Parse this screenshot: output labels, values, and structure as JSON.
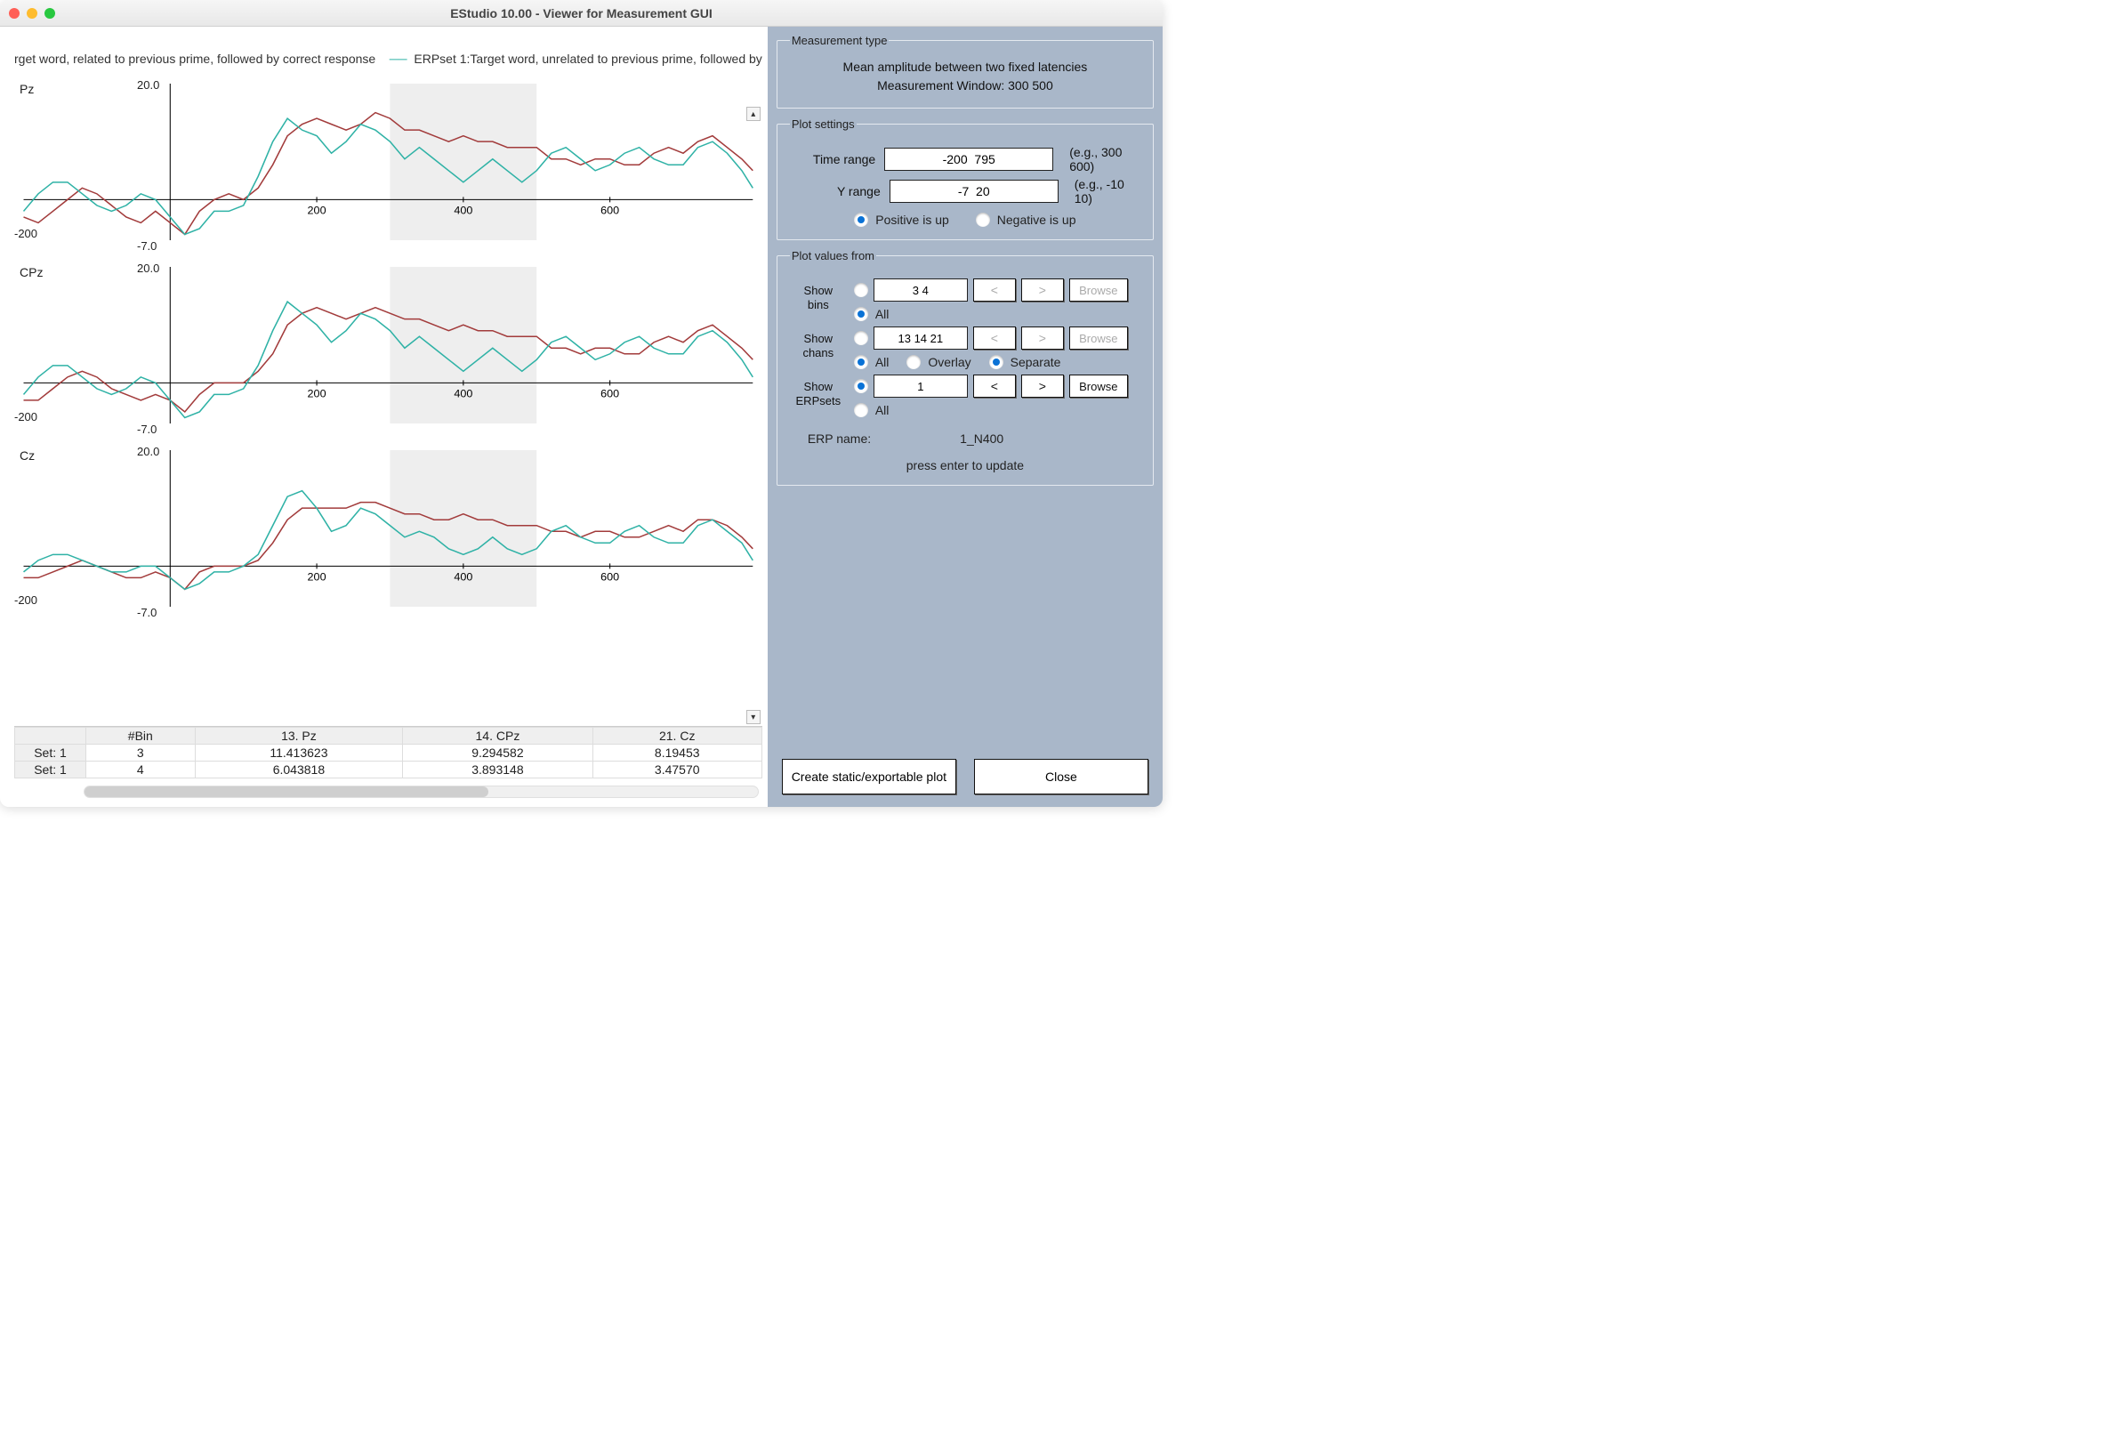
{
  "window": {
    "title": "EStudio 10.00   -   Viewer for Measurement GUI"
  },
  "legend": {
    "series1_truncated": "rget word, related to previous prime, followed by correct response",
    "series2_truncated": "ERPset 1:Target word, unrelated to previous prime, followed by"
  },
  "chart_data": [
    {
      "type": "line",
      "channel": "Pz",
      "xlabel": "",
      "ylabel": "",
      "xlim": [
        -200,
        795
      ],
      "ylim": [
        -7,
        20
      ],
      "xticks": [
        200,
        400,
        600
      ],
      "yticks": [
        -7.0,
        20.0
      ],
      "highlight_window": [
        300,
        500
      ],
      "series": [
        {
          "name": "related",
          "color": "#a23b3b",
          "x": [
            -200,
            -180,
            -160,
            -140,
            -120,
            -100,
            -80,
            -60,
            -40,
            -20,
            0,
            20,
            40,
            60,
            80,
            100,
            120,
            140,
            160,
            180,
            200,
            220,
            240,
            260,
            280,
            300,
            320,
            340,
            360,
            380,
            400,
            420,
            440,
            460,
            480,
            500,
            520,
            540,
            560,
            580,
            600,
            620,
            640,
            660,
            680,
            700,
            720,
            740,
            760,
            780,
            795
          ],
          "values": [
            -3,
            -4,
            -2,
            0,
            2,
            1,
            -1,
            -3,
            -4,
            -2,
            -4,
            -6,
            -2,
            0,
            1,
            0,
            2,
            6,
            11,
            13,
            14,
            13,
            12,
            13,
            15,
            14,
            12,
            12,
            11,
            10,
            11,
            10,
            10,
            9,
            9,
            9,
            7,
            7,
            6,
            7,
            7,
            6,
            6,
            8,
            9,
            8,
            10,
            11,
            9,
            7,
            5
          ]
        },
        {
          "name": "unrelated",
          "color": "#2fb2a6",
          "x": [
            -200,
            -180,
            -160,
            -140,
            -120,
            -100,
            -80,
            -60,
            -40,
            -20,
            0,
            20,
            40,
            60,
            80,
            100,
            120,
            140,
            160,
            180,
            200,
            220,
            240,
            260,
            280,
            300,
            320,
            340,
            360,
            380,
            400,
            420,
            440,
            460,
            480,
            500,
            520,
            540,
            560,
            580,
            600,
            620,
            640,
            660,
            680,
            700,
            720,
            740,
            760,
            780,
            795
          ],
          "values": [
            -2,
            1,
            3,
            3,
            1,
            -1,
            -2,
            -1,
            1,
            0,
            -3,
            -6,
            -5,
            -2,
            -2,
            -1,
            4,
            10,
            14,
            12,
            11,
            8,
            10,
            13,
            12,
            10,
            7,
            9,
            7,
            5,
            3,
            5,
            7,
            5,
            3,
            5,
            8,
            9,
            7,
            5,
            6,
            8,
            9,
            7,
            6,
            6,
            9,
            10,
            8,
            5,
            2
          ]
        }
      ]
    },
    {
      "type": "line",
      "channel": "CPz",
      "xlabel": "",
      "ylabel": "",
      "xlim": [
        -200,
        795
      ],
      "ylim": [
        -7,
        20
      ],
      "xticks": [
        200,
        400,
        600
      ],
      "yticks": [
        -7.0,
        20.0
      ],
      "highlight_window": [
        300,
        500
      ],
      "series": [
        {
          "name": "related",
          "color": "#a23b3b",
          "x": [
            -200,
            -180,
            -160,
            -140,
            -120,
            -100,
            -80,
            -60,
            -40,
            -20,
            0,
            20,
            40,
            60,
            80,
            100,
            120,
            140,
            160,
            180,
            200,
            220,
            240,
            260,
            280,
            300,
            320,
            340,
            360,
            380,
            400,
            420,
            440,
            460,
            480,
            500,
            520,
            540,
            560,
            580,
            600,
            620,
            640,
            660,
            680,
            700,
            720,
            740,
            760,
            780,
            795
          ],
          "values": [
            -3,
            -3,
            -1,
            1,
            2,
            1,
            -1,
            -2,
            -3,
            -2,
            -3,
            -5,
            -2,
            0,
            0,
            0,
            2,
            5,
            10,
            12,
            13,
            12,
            11,
            12,
            13,
            12,
            11,
            11,
            10,
            9,
            10,
            9,
            9,
            8,
            8,
            8,
            6,
            6,
            5,
            6,
            6,
            5,
            5,
            7,
            8,
            7,
            9,
            10,
            8,
            6,
            4
          ]
        },
        {
          "name": "unrelated",
          "color": "#2fb2a6",
          "x": [
            -200,
            -180,
            -160,
            -140,
            -120,
            -100,
            -80,
            -60,
            -40,
            -20,
            0,
            20,
            40,
            60,
            80,
            100,
            120,
            140,
            160,
            180,
            200,
            220,
            240,
            260,
            280,
            300,
            320,
            340,
            360,
            380,
            400,
            420,
            440,
            460,
            480,
            500,
            520,
            540,
            560,
            580,
            600,
            620,
            640,
            660,
            680,
            700,
            720,
            740,
            760,
            780,
            795
          ],
          "values": [
            -2,
            1,
            3,
            3,
            1,
            -1,
            -2,
            -1,
            1,
            0,
            -3,
            -6,
            -5,
            -2,
            -2,
            -1,
            3,
            9,
            14,
            12,
            10,
            7,
            9,
            12,
            11,
            9,
            6,
            8,
            6,
            4,
            2,
            4,
            6,
            4,
            2,
            4,
            7,
            8,
            6,
            4,
            5,
            7,
            8,
            6,
            5,
            5,
            8,
            9,
            7,
            4,
            1
          ]
        }
      ]
    },
    {
      "type": "line",
      "channel": "Cz",
      "xlabel": "",
      "ylabel": "",
      "xlim": [
        -200,
        795
      ],
      "ylim": [
        -7,
        20
      ],
      "xticks": [
        200,
        400,
        600
      ],
      "yticks": [
        -7.0,
        20.0
      ],
      "highlight_window": [
        300,
        500
      ],
      "series": [
        {
          "name": "related",
          "color": "#a23b3b",
          "x": [
            -200,
            -180,
            -160,
            -140,
            -120,
            -100,
            -80,
            -60,
            -40,
            -20,
            0,
            20,
            40,
            60,
            80,
            100,
            120,
            140,
            160,
            180,
            200,
            220,
            240,
            260,
            280,
            300,
            320,
            340,
            360,
            380,
            400,
            420,
            440,
            460,
            480,
            500,
            520,
            540,
            560,
            580,
            600,
            620,
            640,
            660,
            680,
            700,
            720,
            740,
            760,
            780,
            795
          ],
          "values": [
            -2,
            -2,
            -1,
            0,
            1,
            0,
            -1,
            -2,
            -2,
            -1,
            -2,
            -4,
            -1,
            0,
            0,
            0,
            1,
            4,
            8,
            10,
            10,
            10,
            10,
            11,
            11,
            10,
            9,
            9,
            8,
            8,
            9,
            8,
            8,
            7,
            7,
            7,
            6,
            6,
            5,
            6,
            6,
            5,
            5,
            6,
            7,
            6,
            8,
            8,
            7,
            5,
            3
          ]
        },
        {
          "name": "unrelated",
          "color": "#2fb2a6",
          "x": [
            -200,
            -180,
            -160,
            -140,
            -120,
            -100,
            -80,
            -60,
            -40,
            -20,
            0,
            20,
            40,
            60,
            80,
            100,
            120,
            140,
            160,
            180,
            200,
            220,
            240,
            260,
            280,
            300,
            320,
            340,
            360,
            380,
            400,
            420,
            440,
            460,
            480,
            500,
            520,
            540,
            560,
            580,
            600,
            620,
            640,
            660,
            680,
            700,
            720,
            740,
            760,
            780,
            795
          ],
          "values": [
            -1,
            1,
            2,
            2,
            1,
            0,
            -1,
            -1,
            0,
            0,
            -2,
            -4,
            -3,
            -1,
            -1,
            0,
            2,
            7,
            12,
            13,
            10,
            6,
            7,
            10,
            9,
            7,
            5,
            6,
            5,
            3,
            2,
            3,
            5,
            3,
            2,
            3,
            6,
            7,
            5,
            4,
            4,
            6,
            7,
            5,
            4,
            4,
            7,
            8,
            6,
            4,
            1
          ]
        }
      ]
    }
  ],
  "table": {
    "headers": [
      "#Bin",
      "13. Pz",
      "14. CPz",
      "21. Cz"
    ],
    "rows": [
      {
        "set": "Set: 1",
        "bin": "3",
        "pz": "11.413623",
        "cpz": "9.294582",
        "cz": "8.19453"
      },
      {
        "set": "Set: 1",
        "bin": "4",
        "pz": "6.043818",
        "cpz": "3.893148",
        "cz": "3.47570"
      }
    ]
  },
  "measurement_type": {
    "legend": "Measurement type",
    "line1": "Mean amplitude between two fixed latencies",
    "line2": "Measurement Window: 300  500"
  },
  "plot_settings": {
    "legend": "Plot settings",
    "time_label": "Time range",
    "time_value": "-200  795",
    "time_hint": "(e.g., 300 600)",
    "y_label": "Y range",
    "y_value": "-7  20",
    "y_hint": "(e.g., -10 10)",
    "pos_up": "Positive is up",
    "neg_up": "Negative is up"
  },
  "plot_values": {
    "legend": "Plot values from",
    "show_bins_label": "Show\nbins",
    "bins_value": "3 4",
    "all": "All",
    "show_chans_label": "Show\nchans",
    "chans_value": "13 14 21",
    "overlay": "Overlay",
    "separate": "Separate",
    "show_erpsets_label": "Show\nERPsets",
    "erpsets_value": "1",
    "prev": "<",
    "next": ">",
    "browse": "Browse",
    "erp_name_label": "ERP name:",
    "erp_name_value": "1_N400",
    "press_enter": "press enter to update"
  },
  "buttons": {
    "create_plot": "Create static/exportable plot",
    "close": "Close"
  }
}
